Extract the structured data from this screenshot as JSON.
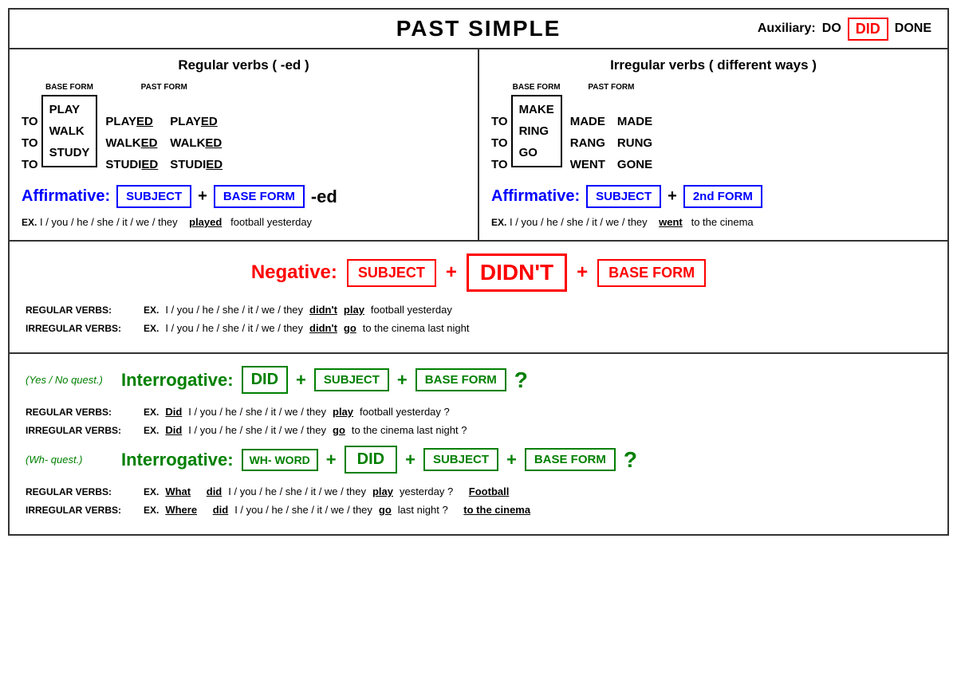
{
  "header": {
    "title": "PAST SIMPLE",
    "auxiliary_label": "Auxiliary:",
    "aux_do": "DO",
    "aux_did": "DID",
    "aux_done": "DONE"
  },
  "regular": {
    "section_title": "Regular verbs  ( -ed )",
    "base_form_label": "BASE FORM",
    "past_form_label": "PAST FORM",
    "verbs": [
      {
        "to": "TO",
        "base": "PLAY",
        "past1": "PLAYED",
        "past2": "PLAYED"
      },
      {
        "to": "TO",
        "base": "WALK",
        "past1": "WALKED",
        "past2": "WALKED"
      },
      {
        "to": "TO",
        "base": "STUDY",
        "past1": "STUDIED",
        "past2": "STUDIED"
      }
    ],
    "affirmative_label": "Affirmative:",
    "subject_box": "SUBJECT",
    "base_form_box": "BASE FORM",
    "ed_suffix": "-ed",
    "ex_label": "EX.",
    "ex_subjects": "I / you / he / she / it / we / they",
    "ex_verb": "played",
    "ex_rest": "football yesterday"
  },
  "irregular": {
    "section_title": "Irregular verbs  ( different ways )",
    "base_form_label": "BASE FORM",
    "past_form_label": "PAST FORM",
    "verbs": [
      {
        "to": "TO",
        "base": "MAKE",
        "past1": "MADE",
        "past2": "MADE"
      },
      {
        "to": "TO",
        "base": "RING",
        "past1": "RANG",
        "past2": "RUNG"
      },
      {
        "to": "TO",
        "base": "GO",
        "past1": "WENT",
        "past2": "GONE"
      }
    ],
    "affirmative_label": "Affirmative:",
    "subject_box": "SUBJECT",
    "form_box": "2nd FORM",
    "ex_label": "EX.",
    "ex_subjects": "I / you / he / she / it / we / they",
    "ex_verb": "went",
    "ex_rest": "to the cinema"
  },
  "negative": {
    "label": "Negative:",
    "subject_box": "SUBJECT",
    "didnt_box": "DIDN'T",
    "base_form_box": "BASE FORM",
    "regular_label": "REGULAR VERBS:",
    "regular_ex": "EX.",
    "regular_subjects": "I / you / he / she / it / we / they",
    "regular_didnt": "didn't",
    "regular_verb": "play",
    "regular_rest": "football yesterday",
    "irregular_label": "IRREGULAR VERBS:",
    "irregular_ex": "EX.",
    "irregular_subjects": "I / you / he / she / it / we / they",
    "irregular_didnt": "didn't",
    "irregular_verb": "go",
    "irregular_rest": "to the cinema last night"
  },
  "interrogative_yesno": {
    "type_label": "(Yes / No quest.)",
    "label": "Interrogative:",
    "did_box": "DID",
    "subject_box": "SUBJECT",
    "base_form_box": "BASE FORM",
    "question_mark": "?",
    "regular_label": "REGULAR VERBS:",
    "regular_ex": "EX.",
    "regular_did": "Did",
    "regular_subjects": "I / you / he / she / it / we / they",
    "regular_verb": "play",
    "regular_rest": "football yesterday  ?",
    "irregular_label": "IRREGULAR VERBS:",
    "irregular_ex": "EX.",
    "irregular_did": "Did",
    "irregular_subjects": "I / you / he / she / it / we / they",
    "irregular_verb": "go",
    "irregular_rest": "to the cinema last night  ?"
  },
  "interrogative_wh": {
    "type_label": "(Wh- quest.)",
    "label": "Interrogative:",
    "wh_box": "WH- WORD",
    "did_box": "DID",
    "subject_box": "SUBJECT",
    "base_form_box": "BASE FORM",
    "question_mark": "?",
    "regular_label": "REGULAR VERBS:",
    "regular_ex": "EX.",
    "regular_wh": "What",
    "regular_did": "did",
    "regular_subjects": "I / you / he / she / it / we / they",
    "regular_verb": "play",
    "regular_rest": "yesterday  ?",
    "regular_tail": "Football",
    "irregular_label": "IRREGULAR VERBS:",
    "irregular_ex": "EX.",
    "irregular_wh": "Where",
    "irregular_did": "did",
    "irregular_subjects": "I / you / he / she / it / we / they",
    "irregular_verb": "go",
    "irregular_rest": "last night  ?",
    "irregular_tail": "to the cinema"
  }
}
